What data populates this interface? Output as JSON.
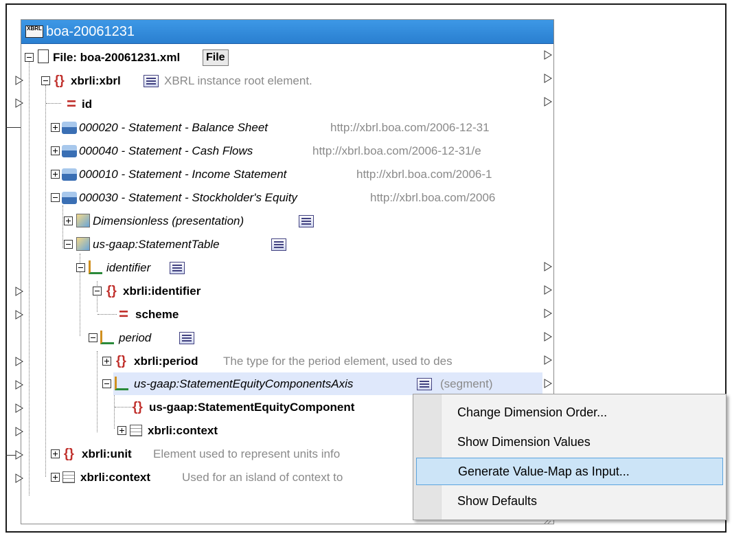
{
  "component": {
    "title": "boa-20061231",
    "badge": "XBRL"
  },
  "tree": {
    "file_label": "File: boa-20061231.xml",
    "file_button": "File",
    "root": {
      "name": "xbrli:xbrl",
      "note": "XBRL instance root element."
    },
    "id": "id",
    "statements": [
      {
        "name": "000020 - Statement - Balance Sheet",
        "url": "http://xbrl.boa.com/2006-12-31"
      },
      {
        "name": "000040 - Statement - Cash Flows",
        "url": "http://xbrl.boa.com/2006-12-31/e"
      },
      {
        "name": "000010 - Statement - Income Statement",
        "url": "http://xbrl.boa.com/2006-1"
      },
      {
        "name": "000030 - Statement - Stockholder's Equity",
        "url": "http://xbrl.boa.com/2006"
      }
    ],
    "dimensionless": "Dimensionless (presentation)",
    "statement_table": "us-gaap:StatementTable",
    "identifier": "identifier",
    "xbrli_identifier": "xbrli:identifier",
    "scheme": "scheme",
    "period": "period",
    "xbrli_period": {
      "name": "xbrli:period",
      "note": "The type for the period element, used to des"
    },
    "axis": {
      "name": "us-gaap:StatementEquityComponentsAxis",
      "note": "(segment)"
    },
    "component_element": "us-gaap:StatementEquityComponent",
    "context_inner": "xbrli:context",
    "unit": {
      "name": "xbrli:unit",
      "note": "Element used to represent units info"
    },
    "context_outer": {
      "name": "xbrli:context",
      "note": "Used for an island of context to"
    }
  },
  "context_menu": {
    "items": [
      "Change Dimension Order...",
      "Show Dimension Values",
      "Generate Value-Map as Input...",
      "Show Defaults"
    ],
    "hovered_index": 2
  },
  "colors": {
    "titlebar": "#2a7fd0",
    "element_icon": "#c0302c",
    "note_text": "#8a8a8a",
    "highlight": "#dfe8fb",
    "menu_hover": "#cce4f7"
  }
}
